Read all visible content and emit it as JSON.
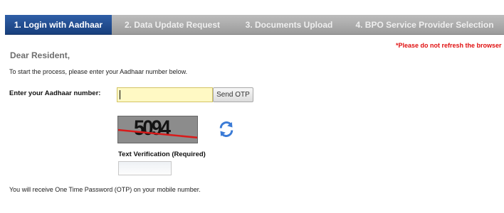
{
  "steps": [
    {
      "label": "1. Login with Aadhaar",
      "active": true
    },
    {
      "label": "2. Data Update Request",
      "active": false
    },
    {
      "label": "3. Documents Upload",
      "active": false
    },
    {
      "label": "4. BPO Service Provider Selection",
      "active": false
    }
  ],
  "warning": "*Please do not refresh the browser",
  "greeting": "Dear Resident,",
  "intro": "To start the process, please enter your Aadhaar number below.",
  "aadhaar": {
    "label": "Enter your Aadhaar number:",
    "value": "",
    "send_otp_label": "Send OTP"
  },
  "captcha": {
    "text": "5094",
    "refresh_icon": "refresh-icon",
    "verification_label": "Text Verification (Required)",
    "verification_value": ""
  },
  "otp_note": "You will receive One Time Password (OTP) on your mobile number.",
  "colors": {
    "active_step": "#1f4a8c",
    "inactive_step": "#a8a8a8",
    "warning": "#e01010",
    "input_highlight": "#fff9c4"
  }
}
